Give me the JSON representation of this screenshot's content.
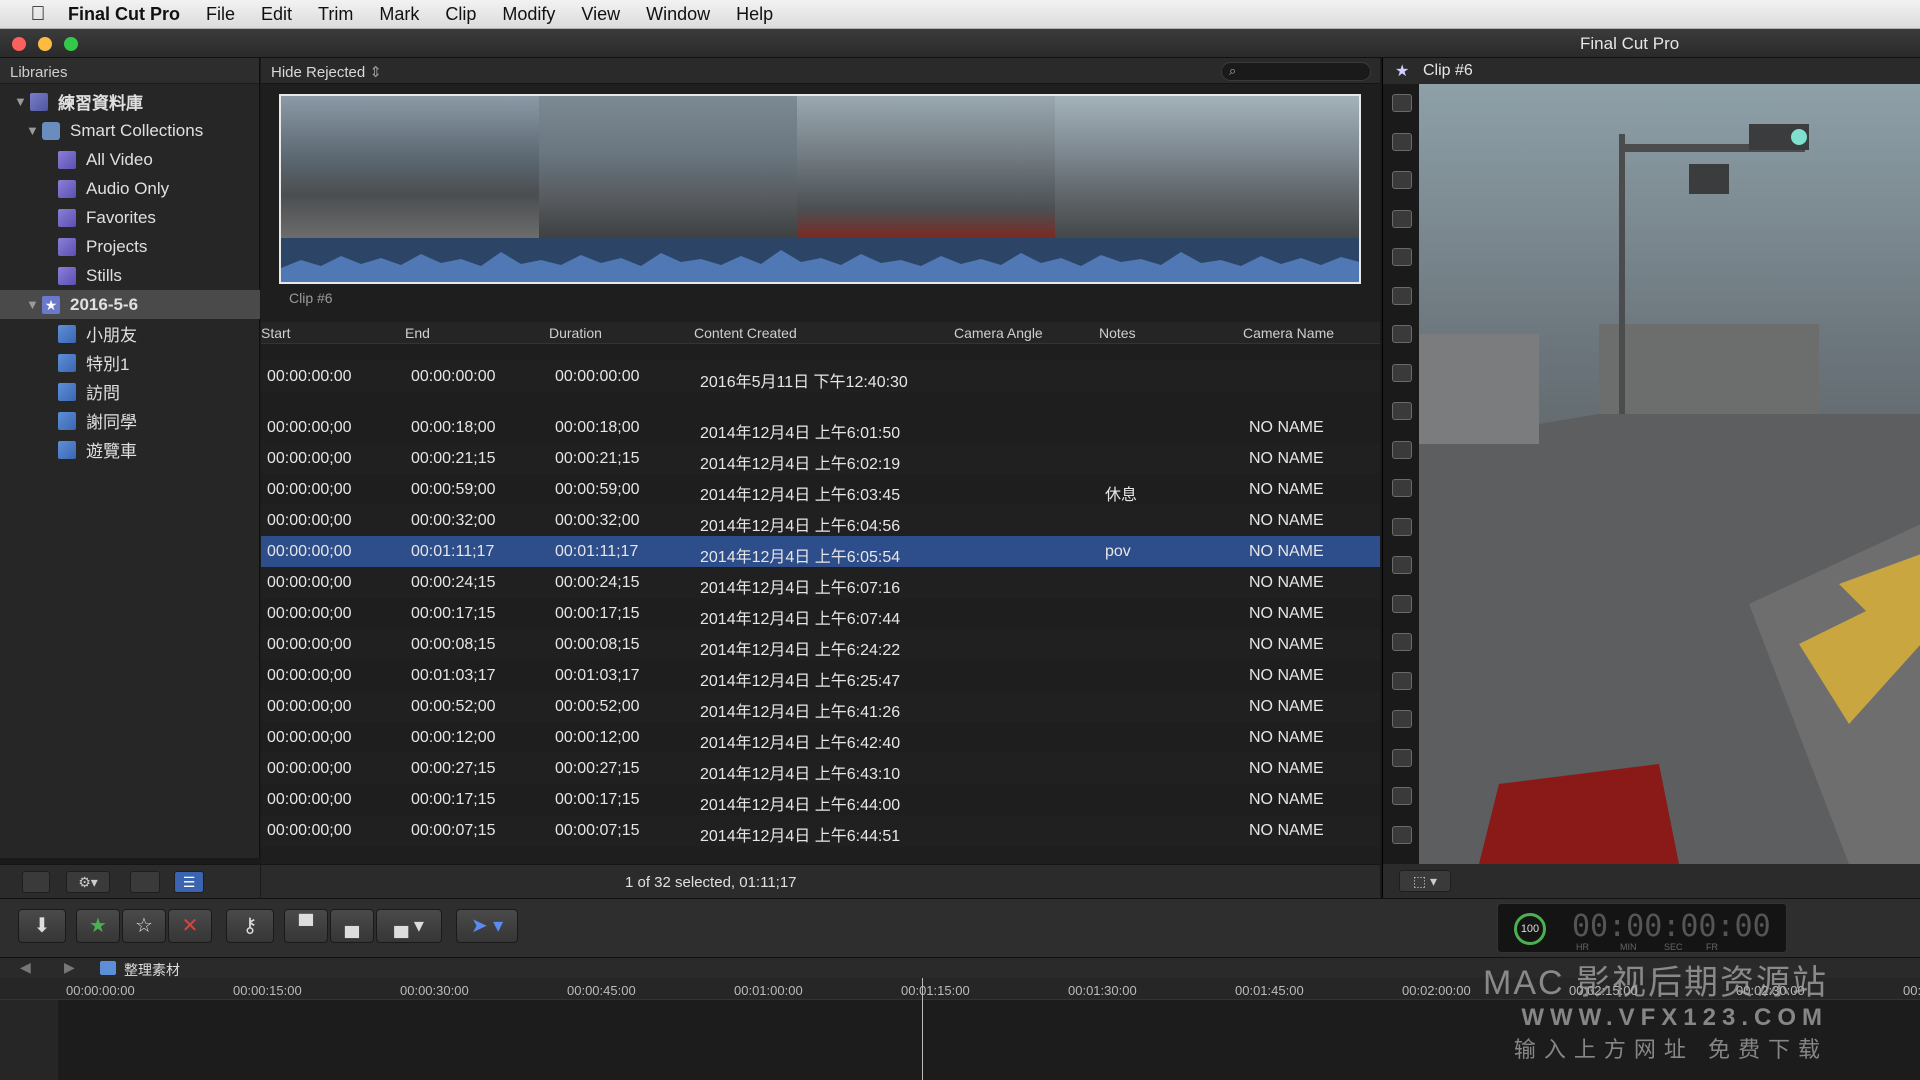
{
  "menubar": {
    "app": "Final Cut Pro",
    "items": [
      "File",
      "Edit",
      "Trim",
      "Mark",
      "Clip",
      "Modify",
      "View",
      "Window",
      "Help"
    ]
  },
  "window": {
    "title": "Final Cut Pro"
  },
  "sidebar": {
    "header": "Libraries",
    "library": "練習資料庫",
    "smart_collections": "Smart Collections",
    "collections": [
      "All Video",
      "Audio Only",
      "Favorites",
      "Projects",
      "Stills"
    ],
    "event": "2016-5-6",
    "keywords": [
      "小朋友",
      "特別1",
      "訪問",
      "謝同學",
      "遊覽車"
    ]
  },
  "browser": {
    "filter": "Hide Rejected",
    "clip_label": "Clip #6",
    "columns": [
      "Start",
      "End",
      "Duration",
      "Content Created",
      "Camera Angle",
      "Notes",
      "Camera Name"
    ],
    "top_row": {
      "start": "00:00:00:00",
      "end": "00:00:00:00",
      "duration": "00:00:00:00",
      "created": "2016年5月11日 下午12:40:30"
    },
    "rows": [
      {
        "start": "00:00:00;00",
        "end": "00:00:18;00",
        "duration": "00:00:18;00",
        "created": "2014年12月4日 上午6:01:50",
        "notes": "",
        "camera": "NO NAME"
      },
      {
        "start": "00:00:00;00",
        "end": "00:00:21;15",
        "duration": "00:00:21;15",
        "created": "2014年12月4日 上午6:02:19",
        "notes": "",
        "camera": "NO NAME"
      },
      {
        "start": "00:00:00;00",
        "end": "00:00:59;00",
        "duration": "00:00:59;00",
        "created": "2014年12月4日 上午6:03:45",
        "notes": "休息",
        "camera": "NO NAME"
      },
      {
        "start": "00:00:00;00",
        "end": "00:00:32;00",
        "duration": "00:00:32;00",
        "created": "2014年12月4日 上午6:04:56",
        "notes": "",
        "camera": "NO NAME"
      },
      {
        "start": "00:00:00;00",
        "end": "00:01:11;17",
        "duration": "00:01:11;17",
        "created": "2014年12月4日 上午6:05:54",
        "notes": "pov",
        "camera": "NO NAME"
      },
      {
        "start": "00:00:00;00",
        "end": "00:00:24;15",
        "duration": "00:00:24;15",
        "created": "2014年12月4日 上午6:07:16",
        "notes": "",
        "camera": "NO NAME"
      },
      {
        "start": "00:00:00;00",
        "end": "00:00:17;15",
        "duration": "00:00:17;15",
        "created": "2014年12月4日 上午6:07:44",
        "notes": "",
        "camera": "NO NAME"
      },
      {
        "start": "00:00:00;00",
        "end": "00:00:08;15",
        "duration": "00:00:08;15",
        "created": "2014年12月4日 上午6:24:22",
        "notes": "",
        "camera": "NO NAME"
      },
      {
        "start": "00:00:00;00",
        "end": "00:01:03;17",
        "duration": "00:01:03;17",
        "created": "2014年12月4日 上午6:25:47",
        "notes": "",
        "camera": "NO NAME"
      },
      {
        "start": "00:00:00;00",
        "end": "00:00:52;00",
        "duration": "00:00:52;00",
        "created": "2014年12月4日 上午6:41:26",
        "notes": "",
        "camera": "NO NAME"
      },
      {
        "start": "00:00:00;00",
        "end": "00:00:12;00",
        "duration": "00:00:12;00",
        "created": "2014年12月4日 上午6:42:40",
        "notes": "",
        "camera": "NO NAME"
      },
      {
        "start": "00:00:00;00",
        "end": "00:00:27;15",
        "duration": "00:00:27;15",
        "created": "2014年12月4日 上午6:43:10",
        "notes": "",
        "camera": "NO NAME"
      },
      {
        "start": "00:00:00;00",
        "end": "00:00:17;15",
        "duration": "00:00:17;15",
        "created": "2014年12月4日 上午6:44:00",
        "notes": "",
        "camera": "NO NAME"
      },
      {
        "start": "00:00:00;00",
        "end": "00:00:07;15",
        "duration": "00:00:07;15",
        "created": "2014年12月4日 上午6:44:51",
        "notes": "",
        "camera": "NO NAME"
      }
    ],
    "selected_index": 4,
    "status": "1 of 32 selected, 01:11;17"
  },
  "viewer": {
    "title": "Clip #6"
  },
  "timecode": {
    "value": "00:00:00:00",
    "gauge": "100",
    "labels": [
      "HR",
      "MIN",
      "SEC",
      "FR"
    ]
  },
  "timeline": {
    "project": "整理素材",
    "ticks": [
      "00:00:00:00",
      "00:00:15:00",
      "00:00:30:00",
      "00:00:45:00",
      "00:01:00:00",
      "00:01:15:00",
      "00:01:30:00",
      "00:01:45:00",
      "00:02:00:00",
      "00:02:15:00",
      "00:02:30:00",
      "00:"
    ]
  },
  "watermark": {
    "line1": "MAC 影视后期资源站",
    "line2": "WWW.VFX123.COM",
    "line3": "输入上方网址 免费下载"
  },
  "colors": {
    "selection": "#2d4e8a",
    "accent_green": "#4caf50",
    "reject_red": "#e04040"
  }
}
